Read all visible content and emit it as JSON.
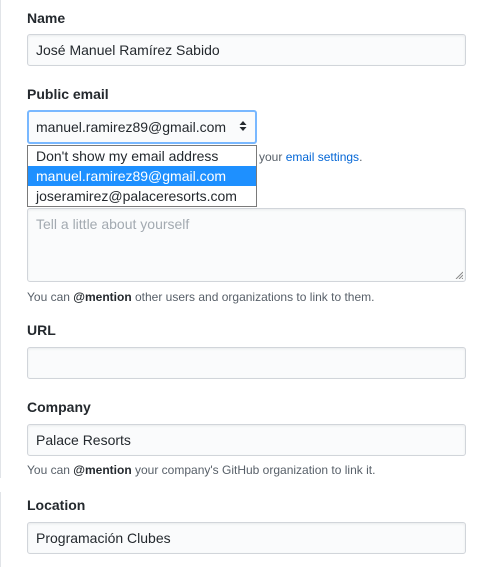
{
  "name": {
    "label": "Name",
    "value": "José Manuel Ramírez Sabido"
  },
  "public_email": {
    "label": "Public email",
    "selected": "manuel.ramirez89@gmail.com",
    "options": [
      "Don't show my email address",
      "manuel.ramirez89@gmail.com",
      "joseramirez@palaceresorts.com"
    ],
    "note_prefix": "your",
    "note_link": "email settings",
    "note_suffix": "."
  },
  "bio": {
    "placeholder": "Tell a little about yourself",
    "help_prefix": "You can",
    "help_mention": "@mention",
    "help_suffix": "other users and organizations to link to them."
  },
  "url": {
    "label": "URL",
    "value": ""
  },
  "company": {
    "label": "Company",
    "value": "Palace Resorts",
    "help_prefix": "You can",
    "help_mention": "@mention",
    "help_suffix": "your company's GitHub organization to link it."
  },
  "location": {
    "label": "Location",
    "value": "Programación Clubes"
  },
  "icons": {
    "select_arrows": "up-down-caret-icon",
    "resize": "resize-grip-icon"
  },
  "colors": {
    "link": "#0366d6",
    "selected_option": "#1e90ff",
    "focus_border": "#79b8ff"
  }
}
